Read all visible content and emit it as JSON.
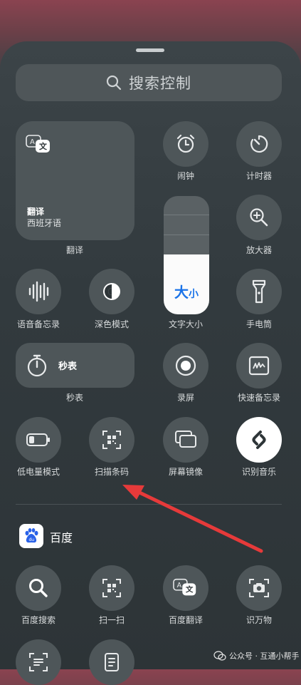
{
  "search": {
    "placeholder": "搜索控制"
  },
  "controls": {
    "translate": {
      "title": "翻译",
      "sub": "西班牙语",
      "label": "翻译"
    },
    "alarm": "闹钟",
    "timer": "计时器",
    "magnifier": "放大器",
    "voice_memo": "语音备忘录",
    "dark_mode": "深色模式",
    "text_size": {
      "label": "文字大小",
      "glyph_big": "大",
      "glyph_small": "小"
    },
    "flashlight": "手电筒",
    "stopwatch": {
      "tile": "秒表",
      "label": "秒表"
    },
    "screen_record": "录屏",
    "quick_note": "快速备忘录",
    "low_power": "低电量模式",
    "scan_code": "扫描条码",
    "screen_mirror": "屏幕镜像",
    "shazam": "识别音乐"
  },
  "baidu": {
    "name": "百度",
    "items": [
      "百度搜索",
      "扫一扫",
      "百度翻译",
      "识万物"
    ]
  },
  "watermark": {
    "text": "公众号 · 互通小帮手"
  },
  "colors": {
    "accent_blue": "#1a73e8",
    "annotation_arrow": "#e63a3a"
  }
}
